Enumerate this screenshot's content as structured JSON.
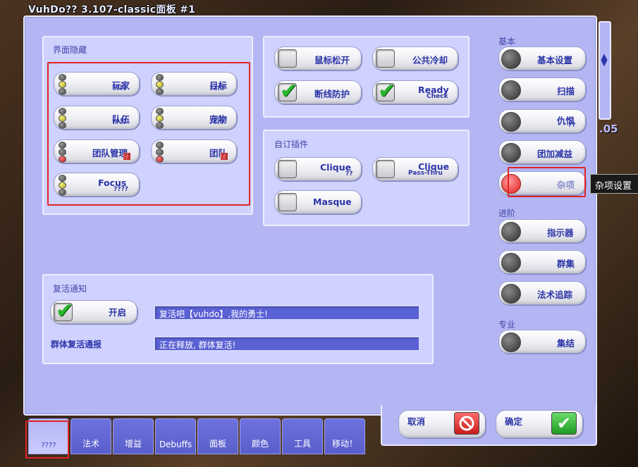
{
  "window": {
    "title": "VuhDo?? 3.107-classic面板 #1"
  },
  "bg_number": ".05",
  "hide_group": {
    "title": "界面隐藏",
    "buttons": [
      {
        "label": "玩家",
        "sub": "????"
      },
      {
        "label": "目标",
        "sub": "????"
      },
      {
        "label": "队伍",
        "sub": "????"
      },
      {
        "label": "宠物",
        "sub": "????"
      },
      {
        "label": "团队管理",
        "sub": "??"
      },
      {
        "label": "团队",
        "sub": "??"
      },
      {
        "label": "Focus",
        "sub": "????"
      }
    ]
  },
  "options_group": {
    "buttons": [
      {
        "label": "鼠标松开",
        "checked": false
      },
      {
        "label": "公共冷却",
        "checked": false
      },
      {
        "label": "断线防护",
        "checked": true
      },
      {
        "label": "Ready",
        "sub": "Check",
        "checked": true
      }
    ]
  },
  "plugins_group": {
    "title": "自订插件",
    "buttons": [
      {
        "label": "Clique",
        "sub": "??",
        "checked": false
      },
      {
        "label": "Clique",
        "sub": "Pass-Thru",
        "checked": false
      },
      {
        "label": "Masque",
        "checked": false
      }
    ]
  },
  "resurrect_group": {
    "title": "复活通知",
    "enable_label": "开启",
    "enable_checked": true,
    "message_value": "复活吧【vuhdo】,我的勇士!",
    "group_label": "群体复活通报",
    "group_value": "正在释放, 群体复活!"
  },
  "side_menu": {
    "basic_header": "基本",
    "basic_items": [
      "基本设置",
      "扫描",
      "仇恨",
      "团加减益",
      "杂项"
    ],
    "threat_sub": "??",
    "advanced_header": "进阶",
    "advanced_items": [
      "指示器",
      "群集",
      "法术追踪"
    ],
    "pro_header": "专业",
    "pro_items": [
      "集结"
    ],
    "active_item": "杂项"
  },
  "tooltip": "杂项设置",
  "footer": {
    "cancel_label": "取消",
    "ok_label": "确定"
  },
  "tabs": [
    "????",
    "法术",
    "增益",
    "Debuffs",
    "面板",
    "颜色",
    "工具",
    "移动！"
  ],
  "active_tab": "????"
}
